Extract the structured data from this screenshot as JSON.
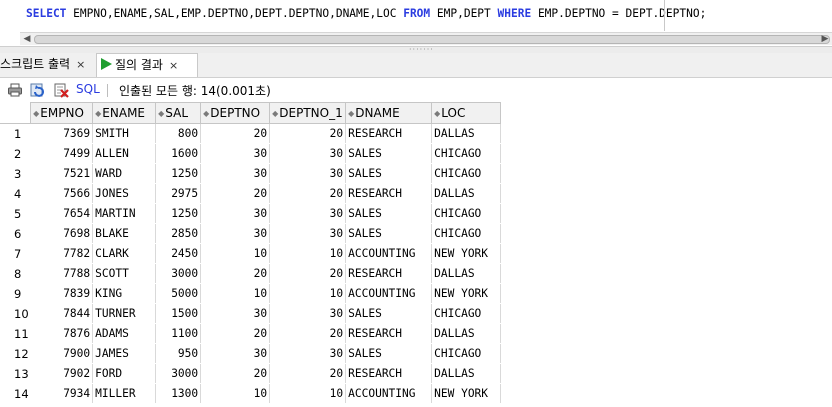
{
  "editor": {
    "sql_tokens": [
      {
        "text": "SELECT",
        "kw": true
      },
      {
        "text": " EMPNO,ENAME,SAL,EMP.DEPTNO,DEPT.DEPTNO,DNAME,LOC ",
        "kw": false
      },
      {
        "text": "FROM",
        "kw": true
      },
      {
        "text": " EMP,DEPT ",
        "kw": false
      },
      {
        "text": "WHERE",
        "kw": true
      },
      {
        "text": " EMP.DEPTNO = DEPT.DEPTNO;",
        "kw": false
      }
    ]
  },
  "tabs": [
    {
      "label": "스크립트 출력",
      "close": "×",
      "active": false
    },
    {
      "label": "질의 결과",
      "close": "×",
      "active": true
    }
  ],
  "toolbar": {
    "sql_label": "SQL",
    "separator": "|",
    "status": "인출된 모든 행: 14(0.001초)"
  },
  "grid": {
    "columns": [
      "EMPNO",
      "ENAME",
      "SAL",
      "DEPTNO",
      "DEPTNO_1",
      "DNAME",
      "LOC"
    ],
    "rows": [
      [
        "1",
        "7369",
        "SMITH",
        "800",
        "20",
        "20",
        "RESEARCH",
        "DALLAS"
      ],
      [
        "2",
        "7499",
        "ALLEN",
        "1600",
        "30",
        "30",
        "SALES",
        "CHICAGO"
      ],
      [
        "3",
        "7521",
        "WARD",
        "1250",
        "30",
        "30",
        "SALES",
        "CHICAGO"
      ],
      [
        "4",
        "7566",
        "JONES",
        "2975",
        "20",
        "20",
        "RESEARCH",
        "DALLAS"
      ],
      [
        "5",
        "7654",
        "MARTIN",
        "1250",
        "30",
        "30",
        "SALES",
        "CHICAGO"
      ],
      [
        "6",
        "7698",
        "BLAKE",
        "2850",
        "30",
        "30",
        "SALES",
        "CHICAGO"
      ],
      [
        "7",
        "7782",
        "CLARK",
        "2450",
        "10",
        "10",
        "ACCOUNTING",
        "NEW YORK"
      ],
      [
        "8",
        "7788",
        "SCOTT",
        "3000",
        "20",
        "20",
        "RESEARCH",
        "DALLAS"
      ],
      [
        "9",
        "7839",
        "KING",
        "5000",
        "10",
        "10",
        "ACCOUNTING",
        "NEW YORK"
      ],
      [
        "10",
        "7844",
        "TURNER",
        "1500",
        "30",
        "30",
        "SALES",
        "CHICAGO"
      ],
      [
        "11",
        "7876",
        "ADAMS",
        "1100",
        "20",
        "20",
        "RESEARCH",
        "DALLAS"
      ],
      [
        "12",
        "7900",
        "JAMES",
        "950",
        "30",
        "30",
        "SALES",
        "CHICAGO"
      ],
      [
        "13",
        "7902",
        "FORD",
        "3000",
        "20",
        "20",
        "RESEARCH",
        "DALLAS"
      ],
      [
        "14",
        "7934",
        "MILLER",
        "1300",
        "10",
        "10",
        "ACCOUNTING",
        "NEW YORK"
      ]
    ]
  },
  "colors": {
    "keyword": "#2b3ce0",
    "run_icon": "#1f9e2f"
  }
}
